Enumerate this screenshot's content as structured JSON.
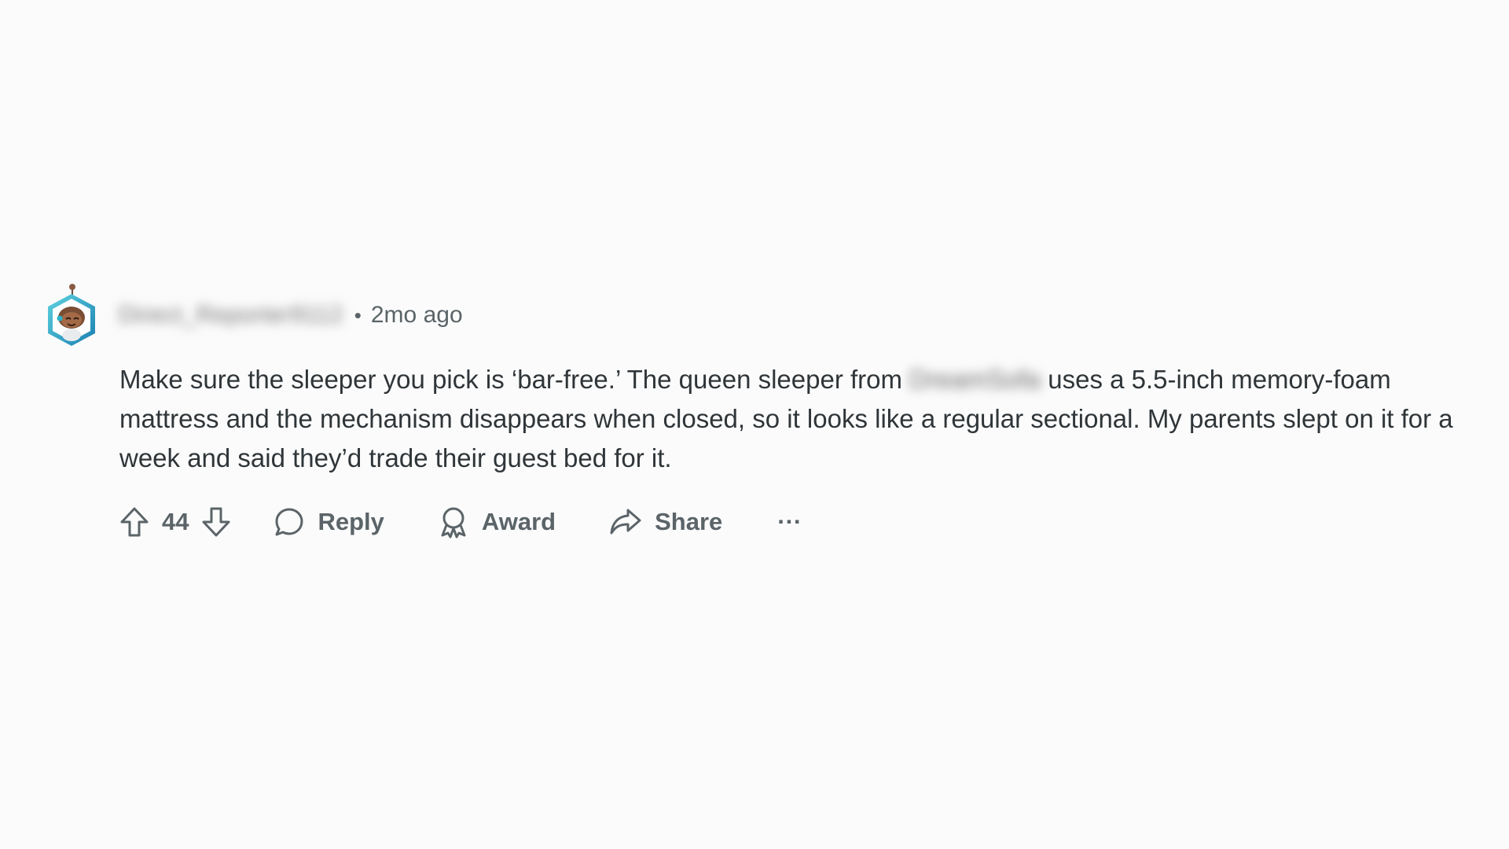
{
  "comment": {
    "author": "Direct_Reporter9112",
    "separator": "•",
    "timestamp": "2mo ago",
    "body_before": "Make sure the sleeper you pick is ‘bar-free.’ The queen sleeper from ",
    "body_redacted": "DreamSofa",
    "body_after": " uses a 5.5-inch memory-foam mattress and the mechanism disappears when closed, so it looks like a regular sectional. My parents slept on it for a week and said they’d trade their guest bed for it.",
    "vote_count": "44",
    "actions": {
      "reply": "Reply",
      "award": "Award",
      "share": "Share",
      "more": "···"
    }
  },
  "icons": {
    "upvote": "upvote-arrow-icon",
    "downvote": "downvote-arrow-icon",
    "reply": "speech-bubble-icon",
    "award": "ribbon-award-icon",
    "share": "share-arrow-icon",
    "more": "ellipsis-icon"
  },
  "colors": {
    "background": "#fbfbfb",
    "text": "#2f3538",
    "muted": "#5b6468",
    "avatar_ring": "#2ab3c9"
  }
}
